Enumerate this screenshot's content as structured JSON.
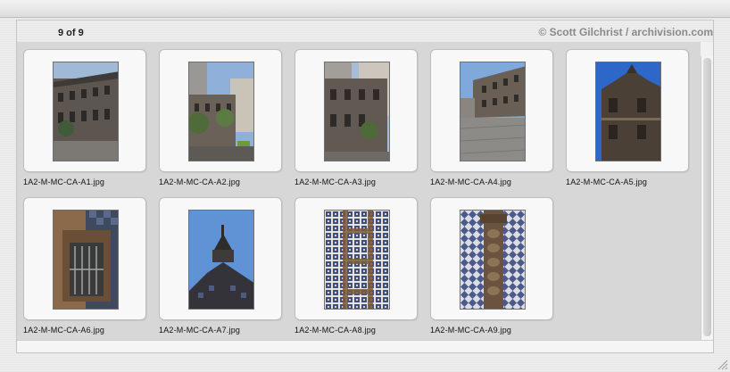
{
  "header": {
    "counter": "9 of 9",
    "credit": "© Scott Gilchrist / archivision.com"
  },
  "thumbnails": [
    {
      "filename": "1A2-M-MC-CA-A1.jpg",
      "icon": "building-facade-photo"
    },
    {
      "filename": "1A2-M-MC-CA-A2.jpg",
      "icon": "street-view-photo"
    },
    {
      "filename": "1A2-M-MC-CA-A3.jpg",
      "icon": "building-corner-photo"
    },
    {
      "filename": "1A2-M-MC-CA-A4.jpg",
      "icon": "plaza-street-photo"
    },
    {
      "filename": "1A2-M-MC-CA-A5.jpg",
      "icon": "tiled-tower-photo"
    },
    {
      "filename": "1A2-M-MC-CA-A6.jpg",
      "icon": "window-detail-photo"
    },
    {
      "filename": "1A2-M-MC-CA-A7.jpg",
      "icon": "finial-sky-photo"
    },
    {
      "filename": "1A2-M-MC-CA-A8.jpg",
      "icon": "tile-pattern-photo"
    },
    {
      "filename": "1A2-M-MC-CA-A9.jpg",
      "icon": "carved-pilaster-photo"
    }
  ],
  "colors": {
    "sky_blue": "#5f93d6",
    "tile_blue": "#3d4f7a",
    "stone": "#6d6258",
    "panel_bg": "#d7d7d7"
  }
}
